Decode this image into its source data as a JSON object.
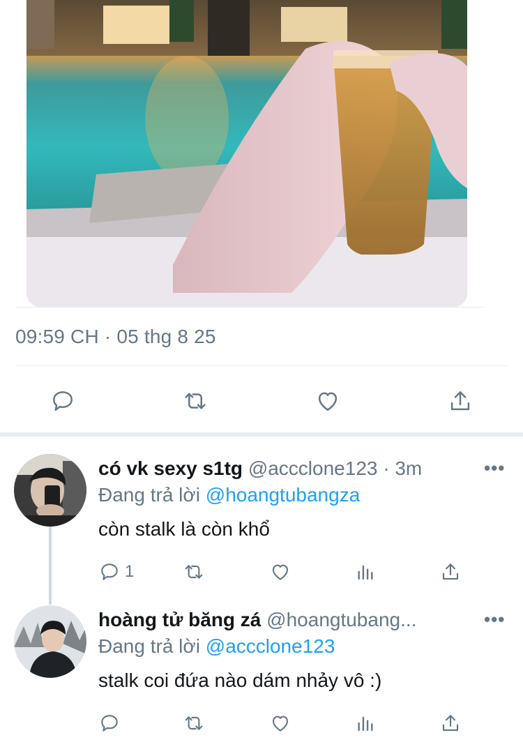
{
  "tweet": {
    "timestamp": "09:59 CH · 05 thg 8 25"
  },
  "icons": {
    "reply": "reply-icon",
    "retweet": "retweet-icon",
    "like": "heart-icon",
    "share": "share-icon",
    "analytics": "analytics-icon",
    "more": "more-icon"
  },
  "colors": {
    "accent": "#1da1f2",
    "secondary_text": "#657786",
    "primary_text": "#14171a",
    "divider": "#e6ecf0"
  },
  "replies": [
    {
      "name": "có vk sexy s1tg",
      "handle": "@accclone123",
      "time": "· 3m",
      "replying_prefix": "Đang trả lời",
      "replying_to": "@hoangtubangza",
      "text": "còn stalk là còn khổ",
      "reply_count": "1",
      "more": "•••"
    },
    {
      "name": "hoàng tử băng zá",
      "handle": "@hoangtubang...",
      "time": "",
      "replying_prefix": "Đang trả lời",
      "replying_to": "@accclone123",
      "text": "stalk coi đứa nào dám nhảy vô :)",
      "reply_count": "",
      "more": "•••"
    }
  ]
}
